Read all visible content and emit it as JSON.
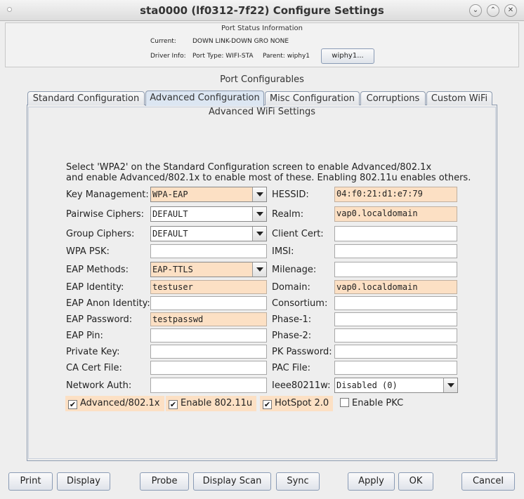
{
  "window": {
    "title": "sta0000  (lf0312-7f22) Configure Settings"
  },
  "port_status": {
    "caption": "Port Status Information",
    "current_label": "Current:",
    "current_value": "DOWN LINK-DOWN GRO  NONE",
    "driver_label": "Driver Info:",
    "port_type": "Port Type: WIFI-STA",
    "parent": "Parent: wiphy1",
    "parent_button": "wiphy1..."
  },
  "configurables_caption": "Port Configurables",
  "tabs": [
    {
      "label": "Standard Configuration"
    },
    {
      "label": "Advanced Configuration"
    },
    {
      "label": "Misc Configuration"
    },
    {
      "label": "Corruptions"
    },
    {
      "label": "Custom WiFi"
    }
  ],
  "advanced": {
    "caption": "Advanced WiFi Settings",
    "note_line1": "Select 'WPA2' on the Standard Configuration screen to enable Advanced/802.1x",
    "note_line2": "and enable Advanced/802.1x to enable most of these. Enabling 802.11u enables others.",
    "left": {
      "key_mgmt_label": "Key Management:",
      "key_mgmt_value": "WPA-EAP",
      "pairwise_label": "Pairwise Ciphers:",
      "pairwise_value": "DEFAULT",
      "group_label": "Group Ciphers:",
      "group_value": "DEFAULT",
      "psk_label": "WPA PSK:",
      "psk_value": "",
      "eap_methods_label": "EAP Methods:",
      "eap_methods_value": "EAP-TTLS",
      "eap_identity_label": "EAP Identity:",
      "eap_identity_value": "testuser",
      "eap_anon_label": "EAP Anon Identity:",
      "eap_anon_value": "",
      "eap_password_label": "EAP Password:",
      "eap_password_value": "testpasswd",
      "eap_pin_label": "EAP Pin:",
      "eap_pin_value": "",
      "private_key_label": "Private Key:",
      "private_key_value": "",
      "ca_cert_label": "CA Cert File:",
      "ca_cert_value": "",
      "network_auth_label": "Network Auth:",
      "network_auth_value": ""
    },
    "right": {
      "hessid_label": "HESSID:",
      "hessid_value": "04:f0:21:d1:e7:79",
      "realm_label": "Realm:",
      "realm_value": "vap0.localdomain",
      "client_cert_label": "Client Cert:",
      "client_cert_value": "",
      "imsi_label": "IMSI:",
      "imsi_value": "",
      "milenage_label": "Milenage:",
      "milenage_value": "",
      "domain_label": "Domain:",
      "domain_value": "vap0.localdomain",
      "consortium_label": "Consortium:",
      "consortium_value": "",
      "phase1_label": "Phase-1:",
      "phase1_value": "",
      "phase2_label": "Phase-2:",
      "phase2_value": "",
      "pk_password_label": "PK Password:",
      "pk_password_value": "",
      "pac_file_label": "PAC File:",
      "pac_file_value": "",
      "ieee80211w_label": "Ieee80211w:",
      "ieee80211w_value": "Disabled (0)"
    },
    "checkboxes": {
      "advanced_8021x": {
        "label": "Advanced/802.1x",
        "checked": "✔"
      },
      "enable_80211u": {
        "label": "Enable 802.11u",
        "checked": "✔"
      },
      "hotspot20": {
        "label": "HotSpot 2.0",
        "checked": "✔"
      },
      "enable_pkc": {
        "label": "Enable PKC",
        "checked": ""
      }
    }
  },
  "buttons": {
    "print": "Print",
    "display": "Display",
    "probe": "Probe",
    "display_scan": "Display Scan",
    "sync": "Sync",
    "apply": "Apply",
    "ok": "OK",
    "cancel": "Cancel"
  },
  "colors": {
    "highlight": "#fce0c4",
    "tab_active": "#dce6f2"
  }
}
